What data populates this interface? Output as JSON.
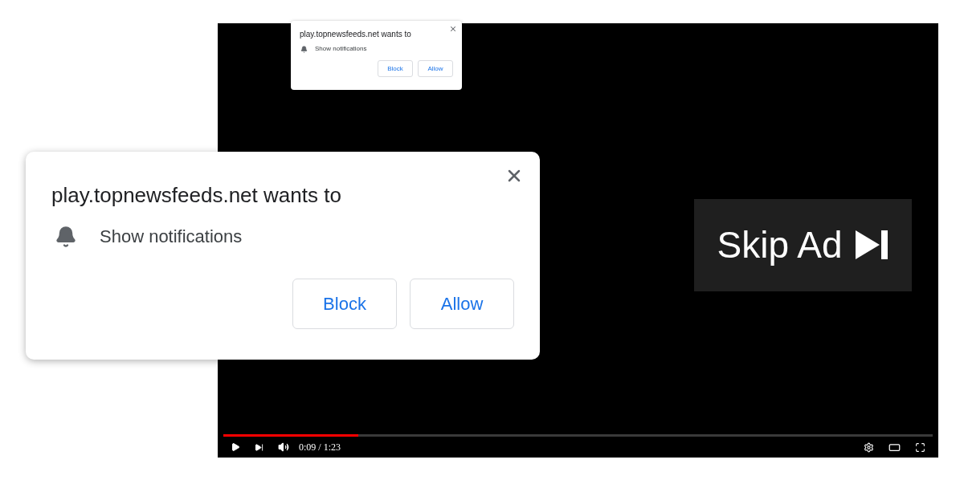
{
  "video_player": {
    "skip_ad": {
      "label": "Skip Ad"
    },
    "progress": {
      "level": 0.19
    },
    "time": "0:09 / 1:23"
  },
  "permission_popups": [
    {
      "kind": "small",
      "title": "play.topnewsfeeds.net wants to",
      "permission": "Show notifications",
      "buttons": [
        "Block",
        "Allow"
      ]
    },
    {
      "kind": "large",
      "title": "play.topnewsfeeds.net wants to",
      "permission": "Show notifications",
      "buttons": [
        "Block",
        "Allow"
      ]
    }
  ]
}
